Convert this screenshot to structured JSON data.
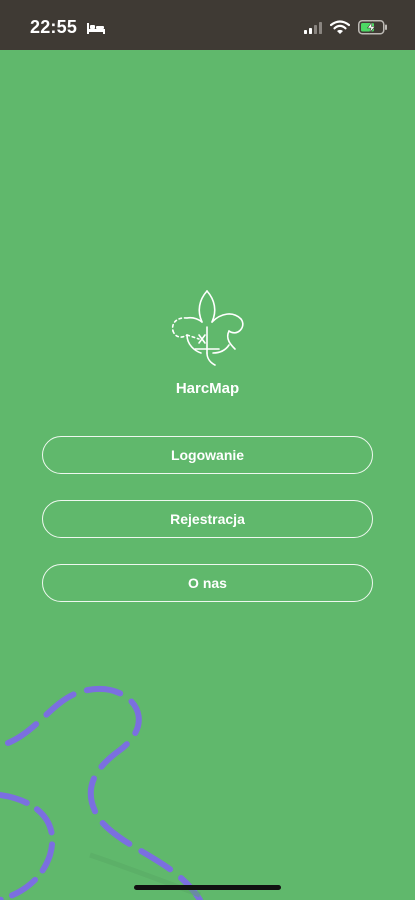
{
  "status_bar": {
    "time": "22:55",
    "icons": [
      "bed-icon",
      "signal-icon",
      "wifi-icon",
      "battery-charging-icon"
    ]
  },
  "app": {
    "name": "HarcMap",
    "logo_icon": "scout-lily-map-icon"
  },
  "buttons": {
    "login_label": "Logowanie",
    "register_label": "Rejestracja",
    "about_label": "O nas"
  },
  "colors": {
    "background": "#60b86c",
    "status_bar": "#3f3a34",
    "accent_path": "#7b6fe0",
    "button_border": "#eef8ef"
  }
}
